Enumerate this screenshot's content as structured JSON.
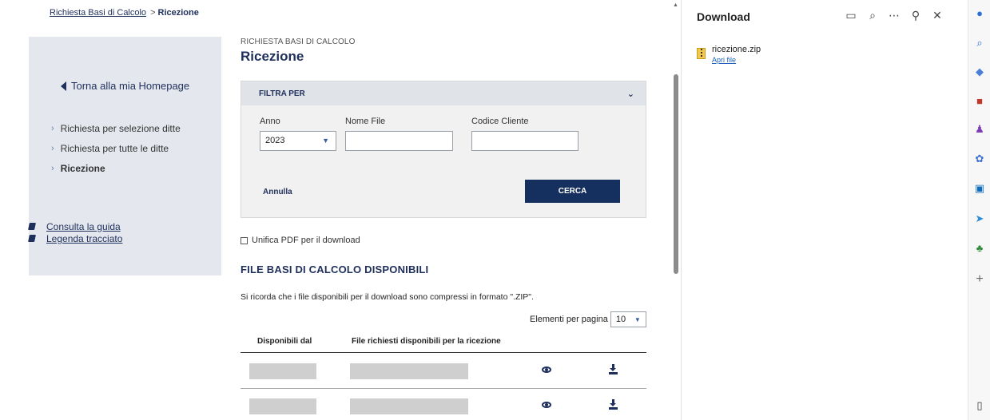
{
  "breadcrumb": {
    "parent": "Richiesta Basi di Calcolo",
    "separator": ">",
    "current": "Ricezione"
  },
  "sidebar": {
    "home_link": "Torna alla mia Homepage",
    "items": [
      {
        "label": "Richiesta per selezione ditte"
      },
      {
        "label": "Richiesta per tutte le ditte"
      },
      {
        "label": "Ricezione"
      }
    ],
    "guides": [
      {
        "label": "Consulta la guida"
      },
      {
        "label": "Legenda tracciato"
      }
    ]
  },
  "header": {
    "kicker": "RICHIESTA BASI DI CALCOLO",
    "title": "Ricezione"
  },
  "filter": {
    "heading": "FILTRA PER",
    "anno_label": "Anno",
    "anno_value": "2023",
    "nome_file_label": "Nome File",
    "nome_file_value": "",
    "codice_cliente_label": "Codice Cliente",
    "codice_cliente_value": "",
    "cancel_label": "Annulla",
    "search_label": "CERCA"
  },
  "unifica_label": "Unifica PDF per il download",
  "section_title": "FILE BASI DI CALCOLO DISPONIBILI",
  "note": "Si ricorda che i file disponibili per il download sono compressi in formato \".ZIP\".",
  "per_page": {
    "label": "Elementi per pagina",
    "value": "10"
  },
  "table": {
    "columns": [
      "Disponibili dal",
      "File richiesti disponibili per la ricezione"
    ],
    "row_count": 2
  },
  "downloads_panel": {
    "title": "Download",
    "file_name": "ricezione.zip",
    "open_label": "Apri file"
  },
  "colors": {
    "brand": "#1f2f5c",
    "button": "#15305e",
    "sidebar_bg": "#e4e8ee"
  }
}
